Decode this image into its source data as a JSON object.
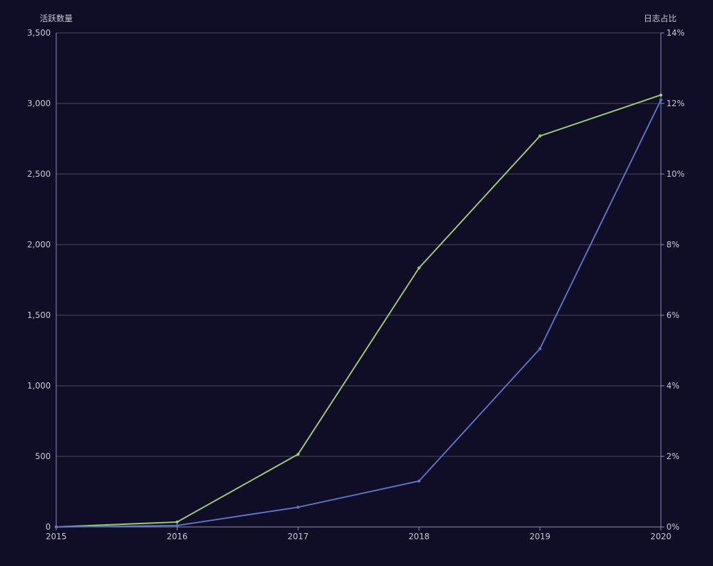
{
  "chart_data": {
    "type": "line",
    "categories": [
      "2015",
      "2016",
      "2017",
      "2018",
      "2019",
      "2020"
    ],
    "y_left": {
      "label": "活跃数量",
      "range": [
        0,
        3500
      ],
      "ticks": [
        "0",
        "500",
        "1,000",
        "1,500",
        "2,000",
        "2,500",
        "3,000",
        "3,500"
      ]
    },
    "y_right": {
      "label": "日志占比",
      "range": [
        0,
        14
      ],
      "ticks": [
        "0%",
        "2%",
        "4%",
        "6%",
        "8%",
        "10%",
        "12%",
        "14%"
      ]
    },
    "series": [
      {
        "axis": "left",
        "color": "#9ccc74",
        "values": [
          0,
          35,
          515,
          1835,
          2770,
          3060
        ]
      },
      {
        "axis": "right",
        "color": "#5d73c4",
        "values": [
          0,
          0.04,
          0.56,
          1.3,
          5.05,
          12.1
        ]
      }
    ],
    "grid": true,
    "legend": "none"
  },
  "colors": {
    "background": "#100e26",
    "grid": "#4a4960",
    "axis": "#8f92c4",
    "text": "#c9c9d6"
  }
}
